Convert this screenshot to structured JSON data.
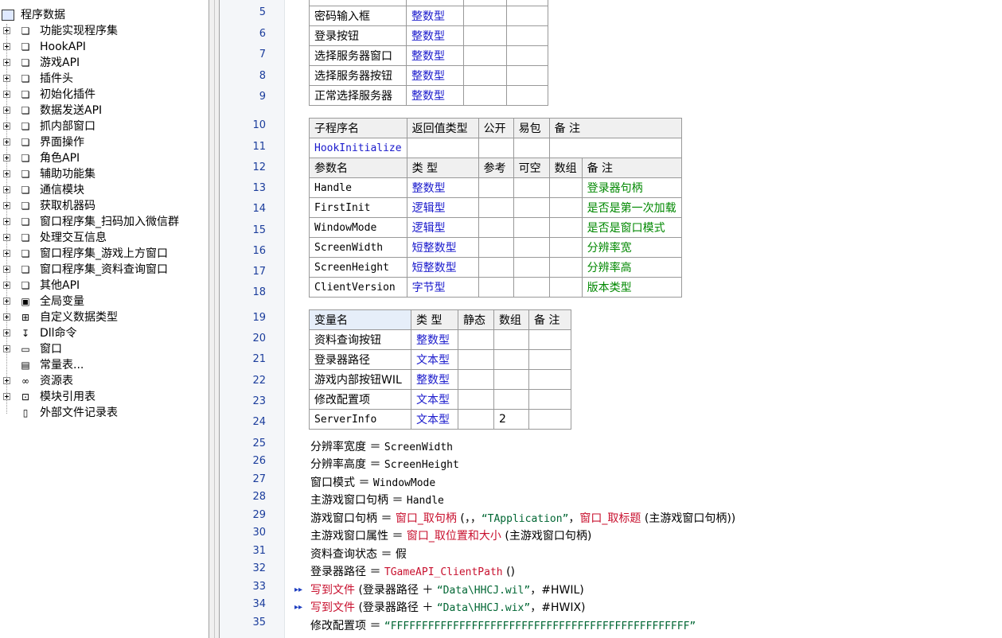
{
  "tree": {
    "root": "程序数据",
    "items": [
      {
        "label": "功能实现程序集",
        "icon": "module-icon"
      },
      {
        "label": "HookAPI",
        "icon": "module-icon"
      },
      {
        "label": "游戏API",
        "icon": "module-icon"
      },
      {
        "label": "插件头",
        "icon": "module-icon"
      },
      {
        "label": "初始化插件",
        "icon": "module-icon"
      },
      {
        "label": "数据发送API",
        "icon": "module-icon"
      },
      {
        "label": "抓内部窗口",
        "icon": "module-icon"
      },
      {
        "label": "界面操作",
        "icon": "module-icon"
      },
      {
        "label": "角色API",
        "icon": "module-icon"
      },
      {
        "label": "辅助功能集",
        "icon": "module-icon"
      },
      {
        "label": "通信模块",
        "icon": "module-icon"
      },
      {
        "label": "获取机器码",
        "icon": "module-icon"
      },
      {
        "label": "窗口程序集_扫码加入微信群",
        "icon": "module-icon"
      },
      {
        "label": "处理交互信息",
        "icon": "module-icon"
      },
      {
        "label": "窗口程序集_游戏上方窗口",
        "icon": "module-icon"
      },
      {
        "label": "窗口程序集_资料查询窗口",
        "icon": "module-icon"
      },
      {
        "label": "其他API",
        "icon": "module-icon"
      },
      {
        "label": "全局变量",
        "icon": "global-var-icon"
      },
      {
        "label": "自定义数据类型",
        "icon": "datatype-icon"
      },
      {
        "label": "Dll命令",
        "icon": "dll-icon"
      },
      {
        "label": "窗口",
        "icon": "window-icon"
      },
      {
        "label": "常量表...",
        "icon": "constant-icon"
      },
      {
        "label": "资源表",
        "icon": "resource-icon"
      },
      {
        "label": "模块引用表",
        "icon": "module-ref-icon"
      },
      {
        "label": "外部文件记录表",
        "icon": "file-icon"
      }
    ]
  },
  "line_numbers": [
    "5",
    "6",
    "7",
    "8",
    "9",
    "10",
    "11",
    "12",
    "13",
    "14",
    "15",
    "16",
    "17",
    "18",
    "19",
    "20",
    "21",
    "22",
    "23",
    "24",
    "25",
    "26",
    "27",
    "28",
    "29",
    "30",
    "31",
    "32",
    "33",
    "34",
    "35"
  ],
  "top_table": {
    "rows": [
      {
        "name": "密码输入框",
        "type": "整数型"
      },
      {
        "name": "登录按钮",
        "type": "整数型"
      },
      {
        "name": "选择服务器窗口",
        "type": "整数型"
      },
      {
        "name": "选择服务器按钮",
        "type": "整数型"
      },
      {
        "name": "正常选择服务器",
        "type": "整数型"
      }
    ]
  },
  "sub_table": {
    "header": [
      "子程序名",
      "返回值类型",
      "公开",
      "易包",
      "备 注"
    ],
    "sub_name": "HookInitialize",
    "param_header": [
      "参数名",
      "类 型",
      "参考",
      "可空",
      "数组",
      "备 注"
    ],
    "params": [
      {
        "name": "Handle",
        "type": "整数型",
        "note": "登录器句柄"
      },
      {
        "name": "FirstInit",
        "type": "逻辑型",
        "note": "是否是第一次加载"
      },
      {
        "name": "WindowMode",
        "type": "逻辑型",
        "note": "是否是窗口模式"
      },
      {
        "name": "ScreenWidth",
        "type": "短整数型",
        "note": "分辨率宽"
      },
      {
        "name": "ScreenHeight",
        "type": "短整数型",
        "note": "分辨率高"
      },
      {
        "name": "ClientVersion",
        "type": "字节型",
        "note": "版本类型"
      }
    ]
  },
  "var_table": {
    "header": [
      "变量名",
      "类 型",
      "静态",
      "数组",
      "备 注"
    ],
    "rows": [
      {
        "name": "资料查询按钮",
        "type": "整数型",
        "array": ""
      },
      {
        "name": "登录器路径",
        "type": "文本型",
        "array": ""
      },
      {
        "name": "游戏内部按钮WIL",
        "type": "整数型",
        "array": ""
      },
      {
        "name": "修改配置项",
        "type": "文本型",
        "array": ""
      },
      {
        "name": "ServerInfo",
        "type": "文本型",
        "array": "2"
      }
    ]
  },
  "code": {
    "l25": {
      "a": "分辨率宽度 ＝ ",
      "b": "ScreenWidth"
    },
    "l26": {
      "a": "分辨率高度 ＝ ",
      "b": "ScreenHeight"
    },
    "l27": {
      "a": "窗口模式 ＝ ",
      "b": "WindowMode"
    },
    "l28": {
      "a": "主游戏窗口句柄 ＝ ",
      "b": "Handle"
    },
    "l29": {
      "a": "游戏窗口句柄 ＝ ",
      "f1": "窗口_取句柄",
      "b": " (，，",
      "s": "“TApplication”",
      "c": "，",
      "f2": "窗口_取标题",
      "d": " (主游戏窗口句柄))"
    },
    "l30": {
      "a": "主游戏窗口属性 ＝ ",
      "f": "窗口_取位置和大小",
      "b": " (主游戏窗口句柄)"
    },
    "l31": {
      "a": "资料查询状态 ＝ ",
      "b": "假"
    },
    "l32": {
      "a": "登录器路径 ＝ ",
      "f": "TGameAPI_ClientPath",
      "b": " ()"
    },
    "l33": {
      "f": "写到文件",
      "a": " (登录器路径 ＋ ",
      "s": "“Data\\HHCJ.wil”",
      "b": "，#HWIL)"
    },
    "l34": {
      "f": "写到文件",
      "a": " (登录器路径 ＋ ",
      "s": "“Data\\HHCJ.wix”",
      "b": "，#HWIX)"
    },
    "l35": {
      "a": "修改配置项 ＝ ",
      "s": "“FFFFFFFFFFFFFFFFFFFFFFFFFFFFFFFFFFFFFFFFFFFFFFFF”"
    }
  }
}
